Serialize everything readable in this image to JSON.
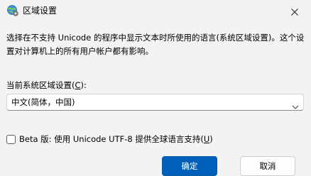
{
  "window": {
    "title": "区域设置",
    "app_icon": "globe-settings-icon",
    "close_icon": "close-icon"
  },
  "description": "选择在不支持 Unicode 的程序中显示文本时所使用的语言(系统区域设置)。这个设置对计算机上的所有用户帐户都有影响。",
  "locale": {
    "label_before": "当前系统区域设置(",
    "label_accesskey": "C",
    "label_after": "):",
    "selected": "中文(简体，中国)",
    "chevron_icon": "chevron-down-icon"
  },
  "beta": {
    "checked": false,
    "label_before": "Beta 版: 使用 Unicode UTF-8 提供全球语言支持(",
    "label_accesskey": "U",
    "label_after": ")"
  },
  "buttons": {
    "ok": "确定",
    "cancel": "取消"
  },
  "colors": {
    "background": "#f3f3f3",
    "accent": "#005fb8"
  }
}
